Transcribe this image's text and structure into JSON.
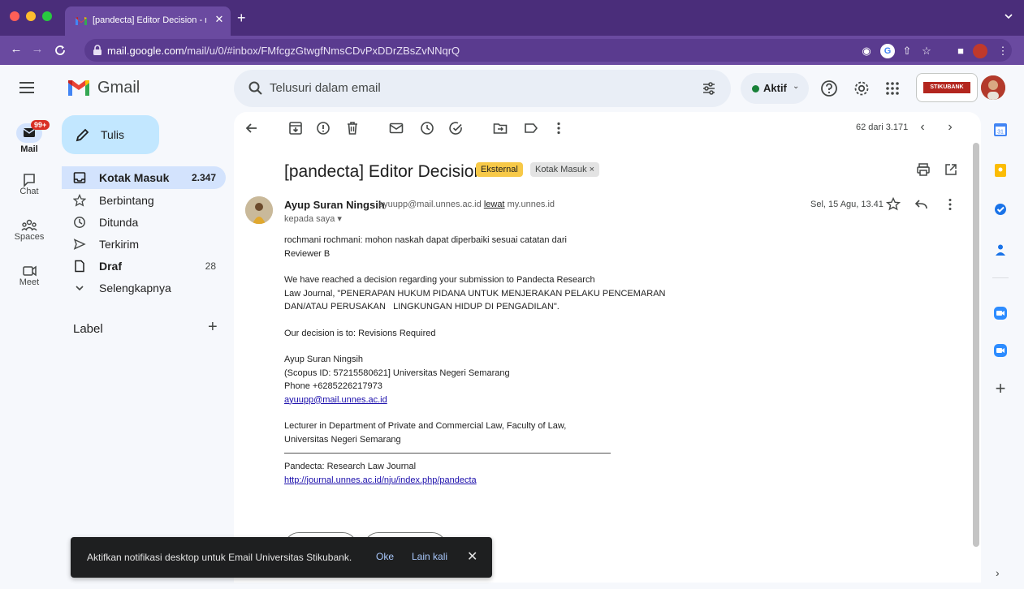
{
  "browser": {
    "tab_title": "[pandecta] Editor Decision - ro",
    "tab_close": "✕",
    "new_tab": "+",
    "url_domain": "mail.google.com",
    "url_path": "/mail/u/0/#inbox/FMfcgzGtwgfNmsCDvPxDDrZBsZvNNqrQ",
    "traffic_colors": [
      "#ff5f57",
      "#febc2e",
      "#28c840"
    ]
  },
  "header": {
    "app_name": "Gmail",
    "search_placeholder": "Telusuri dalam email",
    "status_label": "Aktif",
    "org_name": "STIKUBANK"
  },
  "rail": {
    "mail_label": "Mail",
    "mail_badge": "99+",
    "chat_label": "Chat",
    "spaces_label": "Spaces",
    "meet_label": "Meet"
  },
  "nav": {
    "compose_label": "Tulis",
    "items": [
      {
        "label": "Kotak Masuk",
        "count": "2.347"
      },
      {
        "label": "Berbintang",
        "count": ""
      },
      {
        "label": "Ditunda",
        "count": ""
      },
      {
        "label": "Terkirim",
        "count": ""
      },
      {
        "label": "Draf",
        "count": "28"
      },
      {
        "label": "Selengkapnya",
        "count": ""
      }
    ],
    "labels_heading": "Label",
    "labels_add": "+"
  },
  "message": {
    "counter": "62 dari 3.171",
    "subject": "[pandecta] Editor Decision",
    "chip_external": "Eksternal",
    "chip_inbox": "Kotak Masuk ×",
    "sender_name": "Ayup Suran Ningsih",
    "sender_email": "ayuupp@mail.unnes.ac.id",
    "via_word": "lewat",
    "via_domain": "my.unnes.id",
    "to_line": "kepada saya ▾",
    "date": "Sel, 15 Agu, 13.41",
    "body": {
      "line1": "rochmani rochmani: mohon naskah dapat diperbaiki sesuai catatan dari",
      "line2": "Reviewer B",
      "line3": "We have reached a decision regarding your submission to Pandecta Research",
      "line4": "Law Journal, \"PENERAPAN HUKUM PIDANA UNTUK MENJERAKAN PELAKU PENCEMARAN",
      "line5": "DAN/ATAU PERUSAKAN   LINGKUNGAN HIDUP DI PENGADILAN\".",
      "line6": "Our decision is to: Revisions Required",
      "sig1": "Ayup Suran Ningsih",
      "sig2": "(Scopus ID: 57215580621] Universitas Negeri Semarang",
      "sig3": "Phone +6285226217973",
      "sig_email": "ayuupp@mail.unnes.ac.id",
      "sig4": "Lecturer in Department of Private and Commercial Law, Faculty of Law,",
      "sig5": "Universitas Negeri Semarang",
      "journal": "Pandecta: Research Law Journal",
      "journal_url": "http://journal.unnes.ac.id/nju/index.php/pandecta"
    }
  },
  "snackbar": {
    "message": "Aktifkan notifikasi desktop untuk Email Universitas Stikubank.",
    "ok": "Oke",
    "later": "Lain kali",
    "close": "✕"
  },
  "colors": {
    "browser_bg": "#4a2d7a",
    "accent": "#0b57d0",
    "chip_external": "#f7c948"
  }
}
